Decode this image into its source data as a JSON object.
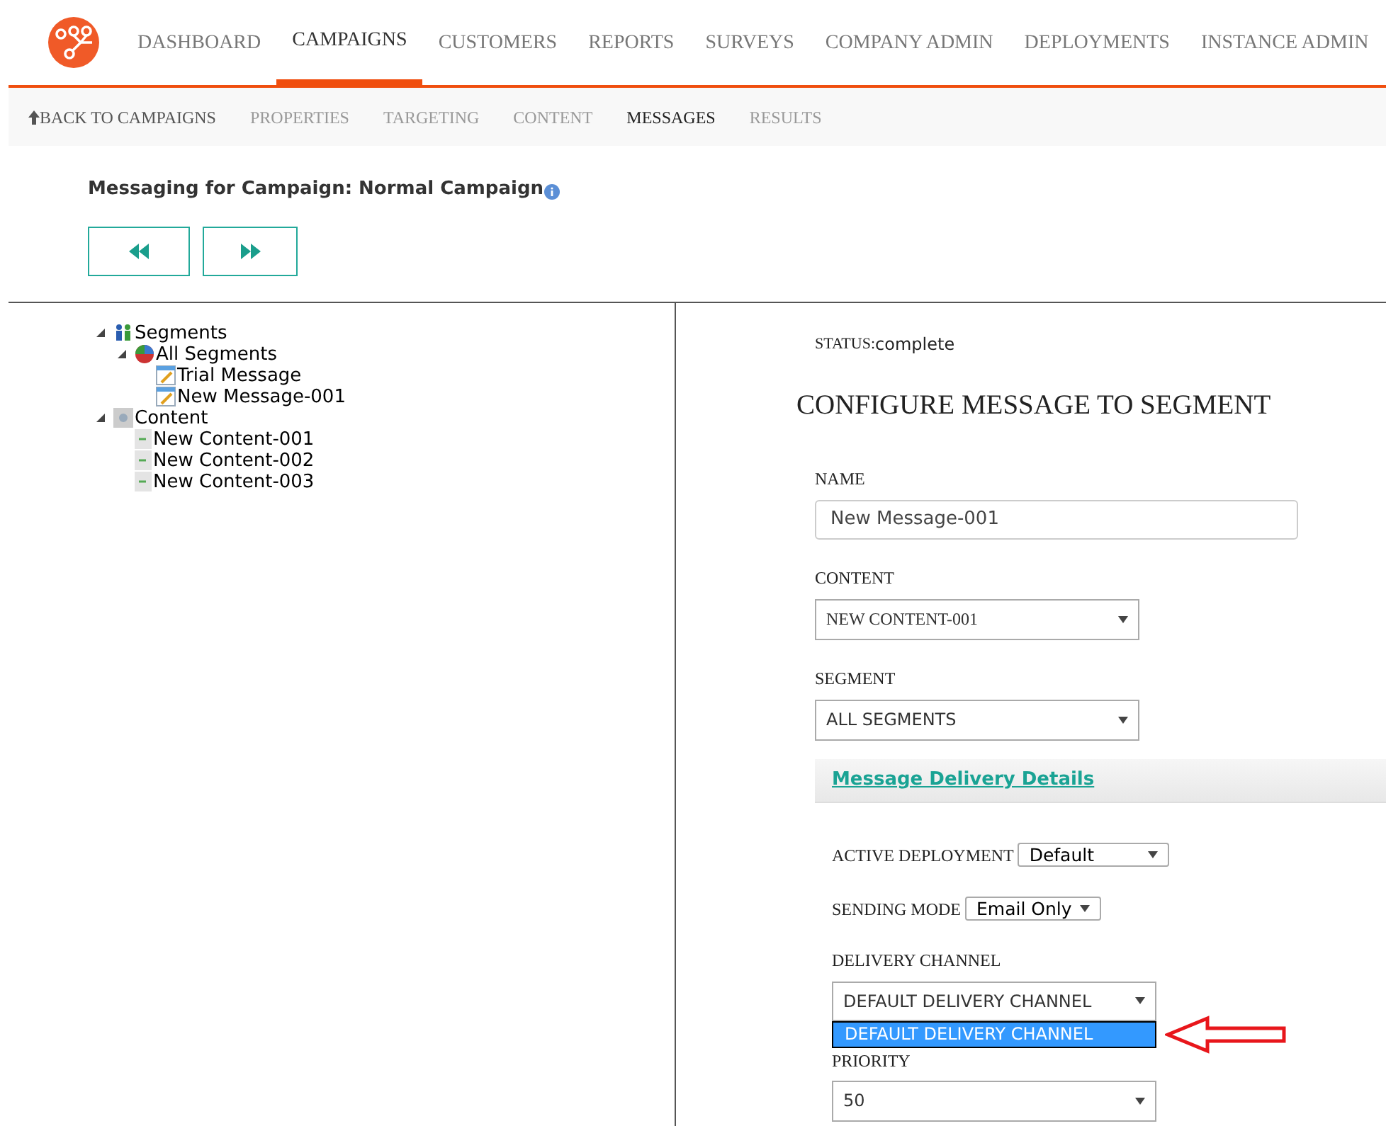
{
  "top_nav": [
    {
      "label": "DASHBOARD",
      "selected": false
    },
    {
      "label": "CAMPAIGNS",
      "selected": true
    },
    {
      "label": "CUSTOMERS",
      "selected": false
    },
    {
      "label": "REPORTS",
      "selected": false
    },
    {
      "label": "SURVEYS",
      "selected": false
    },
    {
      "label": "COMPANY ADMIN",
      "selected": false
    },
    {
      "label": "DEPLOYMENTS",
      "selected": false
    },
    {
      "label": "INSTANCE ADMIN",
      "selected": false
    }
  ],
  "sub_nav": {
    "back_link": "BACK TO CAMPAIGNS",
    "tabs": [
      {
        "label": "PROPERTIES",
        "selected": false
      },
      {
        "label": "TARGETING",
        "selected": false
      },
      {
        "label": "CONTENT",
        "selected": false
      },
      {
        "label": "MESSAGES",
        "selected": true
      },
      {
        "label": "RESULTS",
        "selected": false
      }
    ]
  },
  "page_title": "Messaging for Campaign: Normal Campaign",
  "tree": [
    {
      "label": "Segments",
      "kind": "segments",
      "expanded": true,
      "children": [
        {
          "label": "All Segments",
          "kind": "segment",
          "expanded": true,
          "children": [
            {
              "label": "Trial Message",
              "kind": "message"
            },
            {
              "label": "New Message-001",
              "kind": "message"
            }
          ]
        }
      ]
    },
    {
      "label": "Content",
      "kind": "content-folder",
      "expanded": true,
      "children": [
        {
          "label": "New Content-001",
          "kind": "content"
        },
        {
          "label": "New Content-002",
          "kind": "content"
        },
        {
          "label": "New Content-003",
          "kind": "content"
        }
      ]
    }
  ],
  "form": {
    "status_label": "STATUS:",
    "status_value": "complete",
    "heading": "CONFIGURE MESSAGE TO SEGMENT",
    "name": {
      "label": "NAME",
      "value": "New Message-001"
    },
    "content": {
      "label": "CONTENT",
      "value": "NEW CONTENT-001"
    },
    "segment": {
      "label": "SEGMENT",
      "value": "ALL SEGMENTS"
    },
    "delivery_section": "Message Delivery Details",
    "active_deployment": {
      "label": "ACTIVE DEPLOYMENT",
      "value": "Default"
    },
    "sending_mode": {
      "label": "SENDING MODE",
      "value": "Email Only"
    },
    "delivery_channel": {
      "label": "DELIVERY CHANNEL",
      "value": "DEFAULT DELIVERY CHANNEL",
      "options": [
        {
          "label": "DEFAULT DELIVERY CHANNEL",
          "selected": true
        }
      ]
    },
    "priority": {
      "label": "PRIORITY",
      "value": "50"
    }
  }
}
